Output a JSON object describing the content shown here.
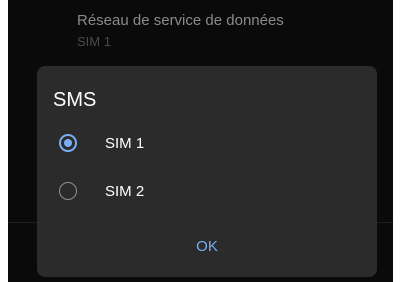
{
  "background_setting": {
    "title": "Réseau de service de données",
    "subtitle": "SIM 1"
  },
  "dialog": {
    "title": "SMS",
    "options": [
      {
        "label": "SIM 1",
        "selected": true
      },
      {
        "label": "SIM 2",
        "selected": false
      }
    ],
    "ok_label": "OK"
  },
  "colors": {
    "accent": "#7aaef4",
    "dialog_bg": "#2b2b2b",
    "screen_bg": "#0a0a0a"
  },
  "icons": {
    "selected": "radio-checked-icon",
    "unselected": "radio-unchecked-icon"
  }
}
